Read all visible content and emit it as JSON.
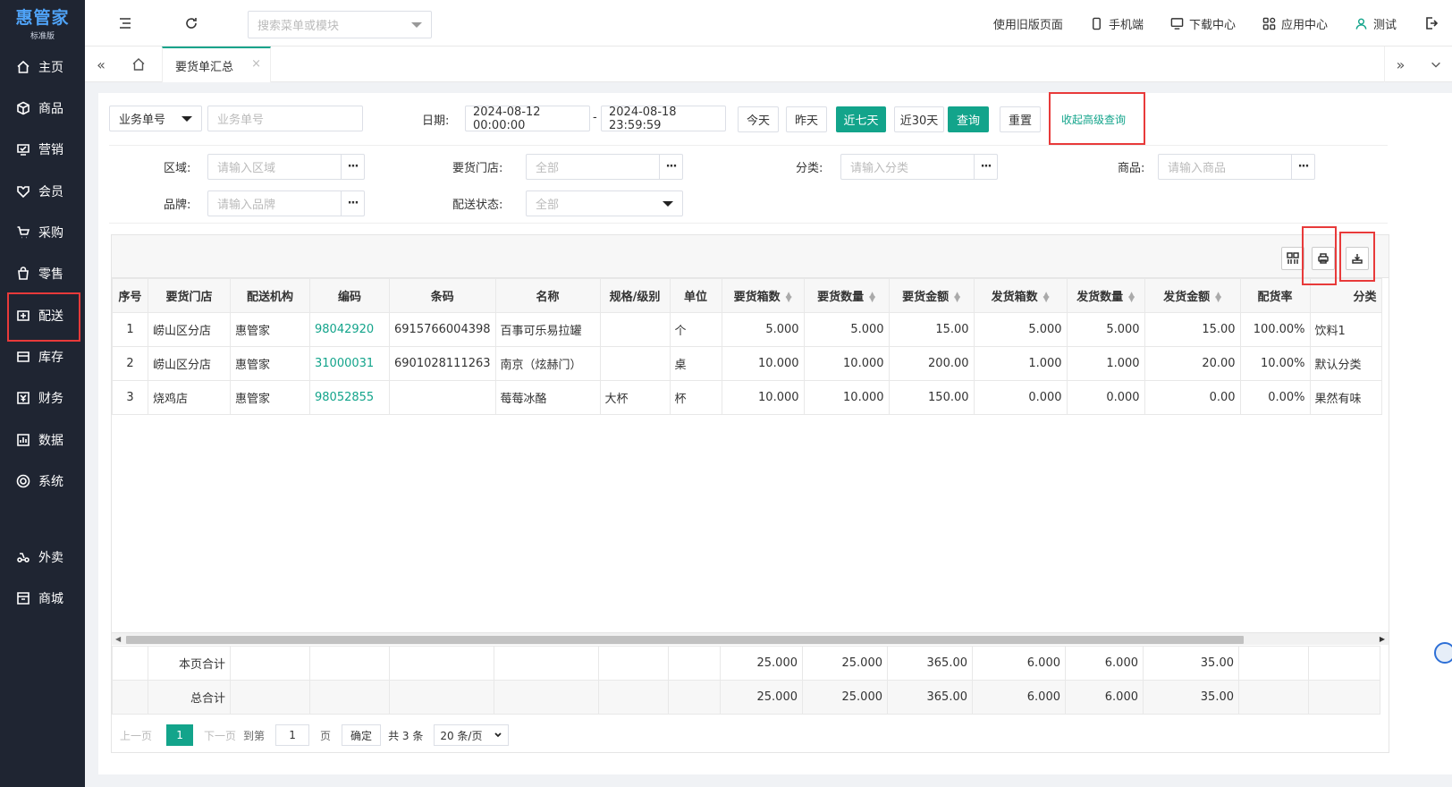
{
  "app": {
    "logo_main": "惠管家",
    "logo_sub": "标准版"
  },
  "sidebar": {
    "items": [
      {
        "label": "主页",
        "icon": "home-icon"
      },
      {
        "label": "商品",
        "icon": "box-icon"
      },
      {
        "label": "营销",
        "icon": "marketing-icon"
      },
      {
        "label": "会员",
        "icon": "member-icon"
      },
      {
        "label": "采购",
        "icon": "cart-icon"
      },
      {
        "label": "零售",
        "icon": "bag-icon"
      },
      {
        "label": "配送",
        "icon": "delivery-icon"
      },
      {
        "label": "库存",
        "icon": "inventory-icon"
      },
      {
        "label": "财务",
        "icon": "finance-icon"
      },
      {
        "label": "数据",
        "icon": "data-icon"
      },
      {
        "label": "系统",
        "icon": "system-icon"
      },
      {
        "label": "外卖",
        "icon": "takeout-icon"
      },
      {
        "label": "商城",
        "icon": "mall-icon"
      }
    ]
  },
  "topbar": {
    "search_placeholder": "搜索菜单或模块",
    "old_version": "使用旧版页面",
    "mobile": "手机端",
    "download": "下载中心",
    "apps": "应用中心",
    "user": "测试"
  },
  "tabs": {
    "active": "要货单汇总"
  },
  "filters": {
    "biz_type": "业务单号",
    "biz_placeholder": "业务单号",
    "date_label": "日期:",
    "date_start": "2024-08-12 00:00:00",
    "date_sep": "-",
    "date_end": "2024-08-18 23:59:59",
    "btn_today": "今天",
    "btn_yesterday": "昨天",
    "btn_7days": "近七天",
    "btn_30days": "近30天",
    "btn_query": "查询",
    "btn_reset": "重置",
    "btn_collapse": "收起高级查询",
    "area_label": "区域:",
    "area_placeholder": "请输入区域",
    "store_label": "要货门店:",
    "store_value": "全部",
    "category_label": "分类:",
    "category_placeholder": "请输入分类",
    "product_label": "商品:",
    "product_placeholder": "请输入商品",
    "brand_label": "品牌:",
    "brand_placeholder": "请输入品牌",
    "status_label": "配送状态:",
    "status_value": "全部"
  },
  "table": {
    "headers": [
      "序号",
      "要货门店",
      "配送机构",
      "编码",
      "条码",
      "名称",
      "规格/级别",
      "单位",
      "要货箱数",
      "要货数量",
      "要货金额",
      "发货箱数",
      "发货数量",
      "发货金额",
      "配货率",
      "分类"
    ],
    "rows": [
      [
        "1",
        "崂山区分店",
        "惠管家",
        "98042920",
        "6915766004398",
        "百事可乐易拉罐",
        "",
        "个",
        "5.000",
        "5.000",
        "15.00",
        "5.000",
        "5.000",
        "15.00",
        "100.00%",
        "饮料1"
      ],
      [
        "2",
        "崂山区分店",
        "惠管家",
        "31000031",
        "6901028111263",
        "南京（炫赫门）",
        "",
        "桌",
        "10.000",
        "10.000",
        "200.00",
        "1.000",
        "1.000",
        "20.00",
        "10.00%",
        "默认分类"
      ],
      [
        "3",
        "烧鸡店",
        "惠管家",
        "98052855",
        "",
        "莓莓冰酪",
        "大杯",
        "杯",
        "10.000",
        "10.000",
        "150.00",
        "0.000",
        "0.000",
        "0.00",
        "0.00%",
        "果然有味"
      ]
    ],
    "page_total": {
      "label": "本页合计",
      "values": [
        "25.000",
        "25.000",
        "365.00",
        "6.000",
        "6.000",
        "35.00"
      ]
    },
    "grand_total": {
      "label": "总合计",
      "values": [
        "25.000",
        "25.000",
        "365.00",
        "6.000",
        "6.000",
        "35.00"
      ]
    }
  },
  "pager": {
    "prev": "上一页",
    "current": "1",
    "next": "下一页",
    "goto": "到第",
    "goto_value": "1",
    "page": "页",
    "confirm": "确定",
    "total": "共 3 条",
    "page_size": "20 条/页"
  }
}
